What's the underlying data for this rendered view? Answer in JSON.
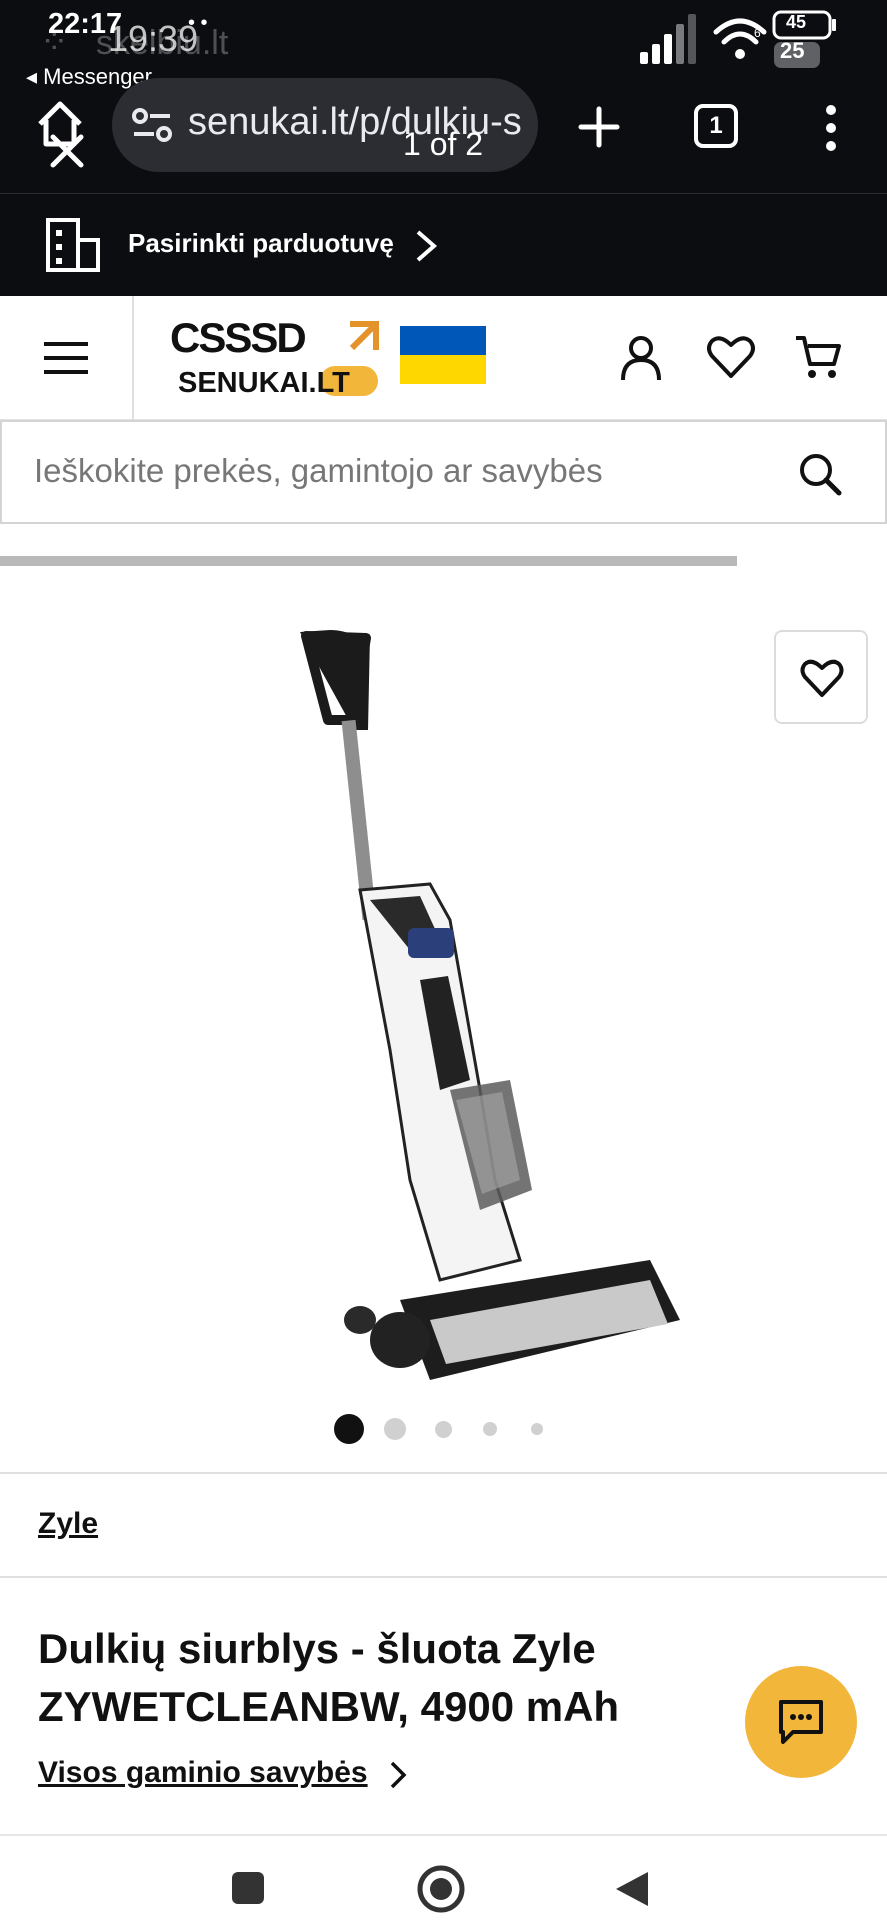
{
  "status_bar": {
    "time": "22:17",
    "ghost_time": "19:39",
    "ghost_site": "skelbiu.lt",
    "back_app": "◂ Messenger",
    "battery": "45",
    "ghost_battery": "25",
    "wifi_badge": "6"
  },
  "browser": {
    "url": "senukai.lt/p/dulkiu-s",
    "page_indicator": "1 of 2",
    "tab_count": "1"
  },
  "store_bar": {
    "label": "Pasirinkti parduotuvę"
  },
  "site_header": {
    "logo_text": "SENUKAI.LT",
    "logo_mark": "CSSSD",
    "flag_colors": [
      "#0057b7",
      "#ffd700"
    ]
  },
  "search": {
    "placeholder": "Ieškokite prekės, gamintojo ar savybės"
  },
  "gallery": {
    "image_count": 5,
    "active_index": 0
  },
  "product": {
    "brand": "Zyle",
    "title": "Dulkių siurblys - šluota Zyle ZYWETCLEANBW, 4900 mAh",
    "all_properties_link": "Visos gaminio savybės"
  },
  "colors": {
    "accent": "#f2b63a",
    "dark_bar": "#0c0d11"
  }
}
